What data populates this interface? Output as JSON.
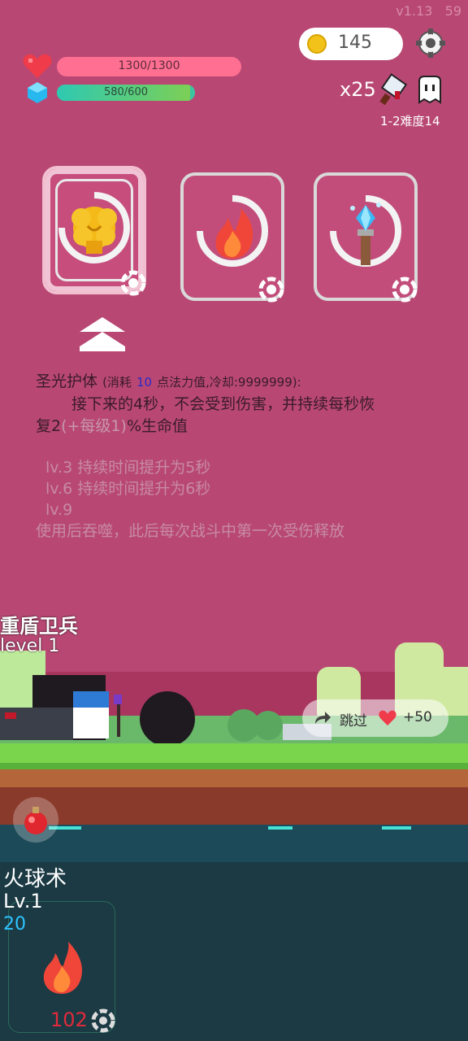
{
  "version": "v1.13",
  "fps": "59",
  "hud": {
    "coins": "145",
    "hp_text": "1300/1300",
    "hp_fraction": 1.0,
    "mp_text": "580/600",
    "mp_fraction": 0.9667,
    "multiplier": "x25",
    "stage": "1-2难度14"
  },
  "skills": [
    {
      "name": "holy-shield",
      "icon": "golden-shield-icon",
      "selected": true
    },
    {
      "name": "fire",
      "icon": "fire-icon",
      "selected": false
    },
    {
      "name": "ice-torch",
      "icon": "ice-torch-icon",
      "selected": false
    }
  ],
  "description": {
    "title": "圣光护体",
    "cost_prefix": "(消耗",
    "cost_value": "10",
    "cost_suffix": "点法力值,冷却:9999999):",
    "line1": "接下来的4秒，不会受到伤害，并持续每秒恢",
    "line2a": "复2",
    "line2b": "(+每级1)",
    "line2c": "%生命值",
    "lv3": "lv.3 持续时间提升为5秒",
    "lv6": "lv.6 持续时间提升为6秒",
    "lv9": "lv.9",
    "lv9_desc": "使用后吞噬，此后每次战斗中第一次受伤释放"
  },
  "enemy": {
    "name": "重盾卫兵",
    "level": "level 1"
  },
  "skip": {
    "label": "跳过",
    "bonus": "+50"
  },
  "active_skill": {
    "name": "火球术",
    "level": "Lv.1",
    "cost": "20",
    "cooldown": "102"
  },
  "colors": {
    "background": "#b84873",
    "hp": "#ff6f92",
    "mp": "#2ec9b2",
    "cost_blue": "#2ec4ff",
    "cooldown_red": "#e02a3a"
  }
}
